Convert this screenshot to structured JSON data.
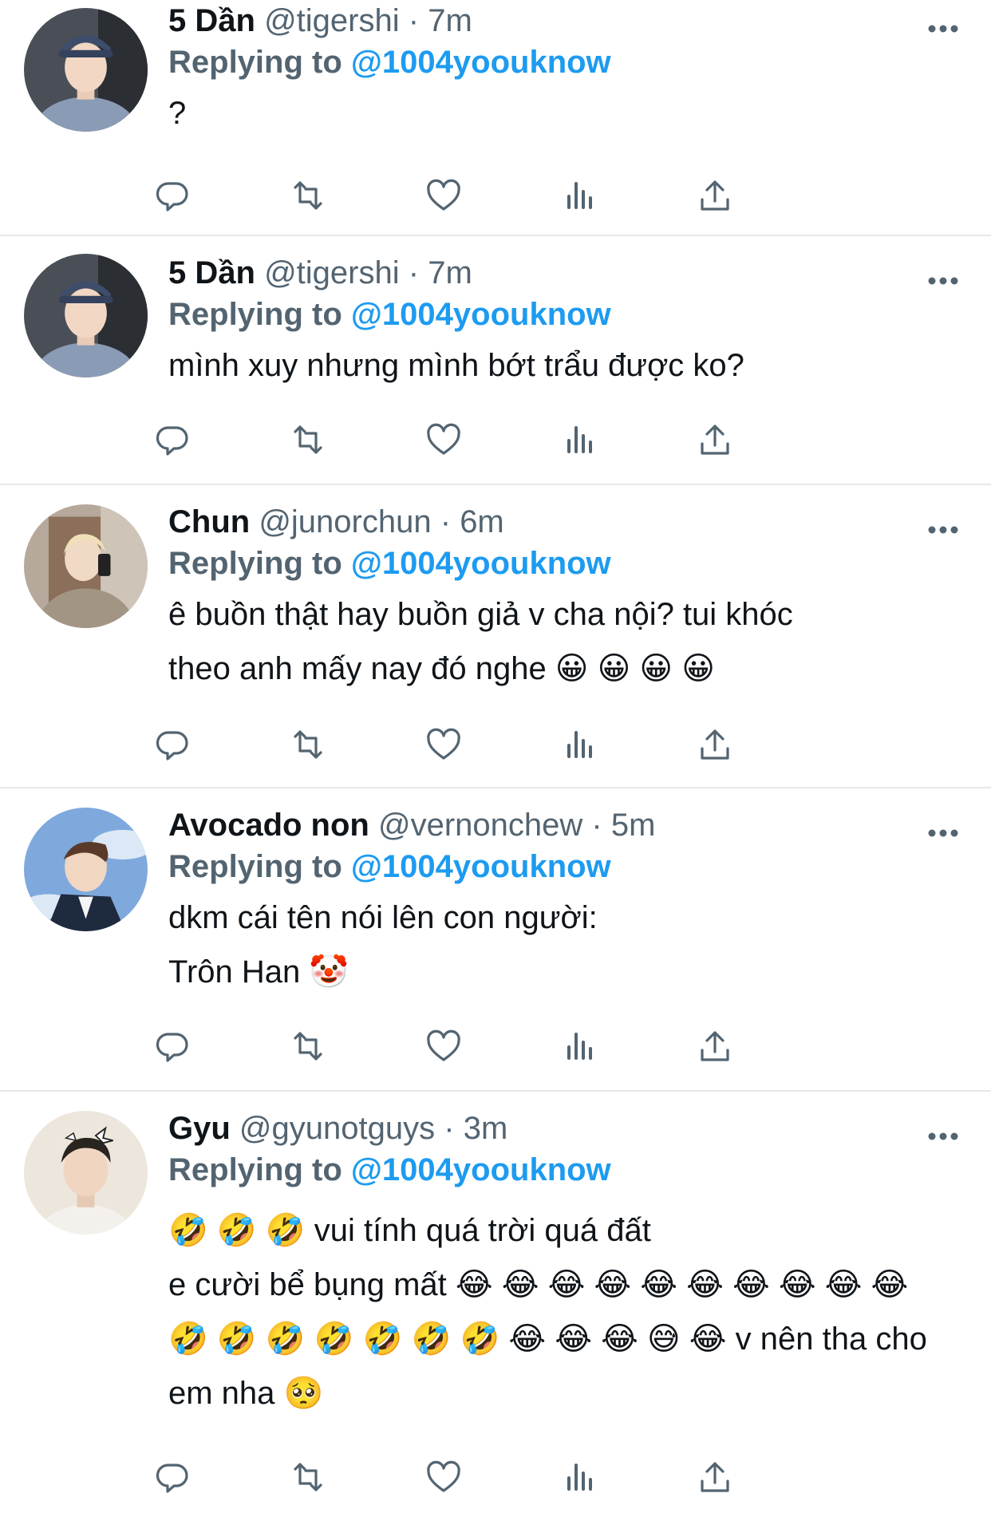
{
  "tweets": [
    {
      "name": "5 Dần",
      "handle": "@tigershi",
      "separator": "·",
      "time": "7m",
      "reply_prefix": "Replying to",
      "reply_to": "@1004yoouknow",
      "lines": [
        "?"
      ],
      "avatar_icon": "person-avatar-cap"
    },
    {
      "name": "5 Dần",
      "handle": "@tigershi",
      "separator": "·",
      "time": "7m",
      "reply_prefix": "Replying to",
      "reply_to": "@1004yoouknow",
      "lines": [
        "mình xuy nhưng mình bớt trẩu được ko?"
      ],
      "avatar_icon": "person-avatar-cap"
    },
    {
      "name": "Chun",
      "handle": "@junorchun",
      "separator": "·",
      "time": "6m",
      "reply_prefix": "Replying to",
      "reply_to": "@1004yoouknow",
      "lines": [
        "ê buồn thật hay buồn giả v cha nội? tui khóc",
        "theo anh mấy nay đó nghe 😀 😀 😀 😀"
      ],
      "avatar_icon": "person-avatar-mirror"
    },
    {
      "name": "Avocado non",
      "handle": "@vernonchew",
      "separator": "·",
      "time": "5m",
      "reply_prefix": "Replying to",
      "reply_to": "@1004yoouknow",
      "lines": [
        "dkm cái tên nói lên con người:",
        "Trôn Han 🤡"
      ],
      "avatar_icon": "person-avatar-sky"
    },
    {
      "name": "Gyu",
      "handle": "@gyunotguys",
      "separator": "·",
      "time": "3m",
      "reply_prefix": "Replying to",
      "reply_to": "@1004yoouknow",
      "lines": [
        "🤣 🤣 🤣 vui tính quá trời quá đất",
        "e cười bể bụng mất 😂 😂 😂 😂 😂 😂 😂 😂 😂 😂",
        "🤣 🤣 🤣 🤣 🤣 🤣 🤣 😂 😂 😂 😅 😂  v nên tha cho",
        "em nha 🥺"
      ],
      "avatar_icon": "person-avatar-bow"
    }
  ],
  "actions": [
    {
      "icon": "reply-icon"
    },
    {
      "icon": "retweet-icon"
    },
    {
      "icon": "like-icon"
    },
    {
      "icon": "views-icon"
    },
    {
      "icon": "share-icon"
    }
  ],
  "colors": {
    "text": "#0f1419",
    "secondary": "#536471",
    "mention": "#1d9bf0",
    "divider": "#e3e8ec"
  }
}
